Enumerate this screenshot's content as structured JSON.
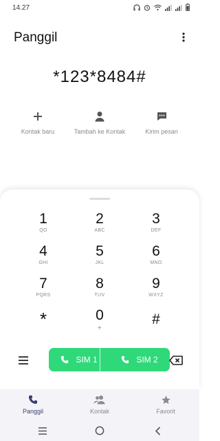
{
  "status_bar": {
    "time": "14.27",
    "icons": [
      "headphones-icon",
      "alarm-icon",
      "wifi-icon",
      "signal-icon",
      "signal-icon",
      "battery-icon"
    ]
  },
  "header": {
    "title": "Panggil",
    "menu_icon": "more-vert-icon"
  },
  "dialer": {
    "number": "*123*8484#"
  },
  "actions": [
    {
      "label": "Kontak baru",
      "icon": "plus-icon"
    },
    {
      "label": "Tambah ke Kontak",
      "icon": "person-icon"
    },
    {
      "label": "Kirim pesan",
      "icon": "message-icon"
    }
  ],
  "keypad": [
    {
      "digit": "1",
      "letters": "QO"
    },
    {
      "digit": "2",
      "letters": "ABC"
    },
    {
      "digit": "3",
      "letters": "DEF"
    },
    {
      "digit": "4",
      "letters": "GHI"
    },
    {
      "digit": "5",
      "letters": "JKL"
    },
    {
      "digit": "6",
      "letters": "MNO"
    },
    {
      "digit": "7",
      "letters": "PQRS"
    },
    {
      "digit": "8",
      "letters": "TUV"
    },
    {
      "digit": "9",
      "letters": "WXYZ"
    },
    {
      "digit": "*",
      "letters": ""
    },
    {
      "digit": "0",
      "letters": "+"
    },
    {
      "digit": "#",
      "letters": ""
    }
  ],
  "call": {
    "sim1_label": "SIM 1",
    "sim2_label": "SIM 2",
    "color": "#2fd97a"
  },
  "bottom_nav": [
    {
      "label": "Panggil",
      "icon": "phone-icon",
      "active": true
    },
    {
      "label": "Kontak",
      "icon": "contacts-icon",
      "active": false
    },
    {
      "label": "Favorit",
      "icon": "star-icon",
      "active": false
    }
  ],
  "colors": {
    "active": "#3c3c78",
    "inactive": "#8a8a8a",
    "call_green": "#2fd97a"
  }
}
